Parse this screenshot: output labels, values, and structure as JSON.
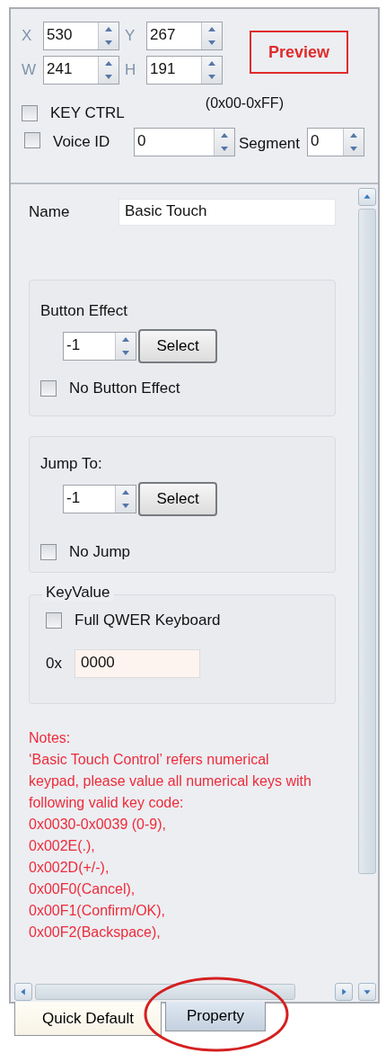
{
  "position": {
    "fields": [
      {
        "label": "X",
        "value": "530"
      },
      {
        "label": "Y",
        "value": "267"
      },
      {
        "label": "W",
        "value": "241"
      },
      {
        "label": "H",
        "value": "191"
      }
    ],
    "preview_button": "Preview"
  },
  "key_ctrl": {
    "label": "KEY CTRL",
    "checked": false,
    "range": "(0x00-0xFF)"
  },
  "voice": {
    "label": "Voice ID",
    "checked": false,
    "value": "0",
    "segment_label": "Segment",
    "segment_value": "0"
  },
  "name": {
    "label": "Name",
    "value": "Basic Touch"
  },
  "groups": [
    {
      "kind": "select",
      "title": "Button Effect",
      "value": "-1",
      "button": "Select",
      "checkbox": {
        "label": "No Button Effect",
        "checked": false
      }
    },
    {
      "kind": "select",
      "title": "Jump To:",
      "value": "-1",
      "button": "Select",
      "checkbox": {
        "label": "No Jump",
        "checked": false
      }
    },
    {
      "kind": "keyvalue",
      "title": "KeyValue",
      "checkbox": {
        "label": "Full QWER Keyboard",
        "checked": false
      },
      "prefix": "0x",
      "value": "0000"
    }
  ],
  "notes": {
    "title": "Notes:",
    "text": "‘Basic Touch Control’ refers numerical keypad, please value all numerical keys with following valid key code:",
    "codes": [
      "0x0030-0x0039 (0-9),",
      "0x002E(.),",
      "0x002D(+/-),",
      "0x00F0(Cancel),",
      "0x00F1(Confirm/OK),",
      "0x00F2(Backspace),"
    ]
  },
  "tabs": [
    {
      "label": "Quick Default",
      "selected": true,
      "circled": false
    },
    {
      "label": "Property",
      "selected": false,
      "circled": true
    }
  ]
}
